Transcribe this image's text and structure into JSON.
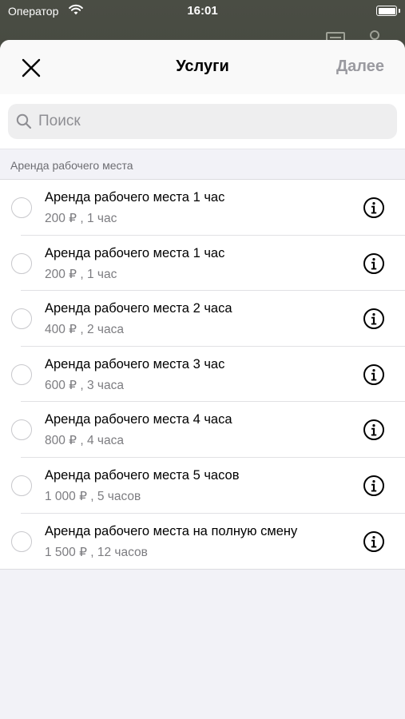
{
  "status_bar": {
    "carrier": "Оператор",
    "time": "16:01"
  },
  "nav": {
    "close_icon": "close-icon",
    "title": "Услуги",
    "next_label": "Далее"
  },
  "search": {
    "placeholder": "Поиск",
    "value": ""
  },
  "section": {
    "title": "Аренда рабочего места"
  },
  "items": [
    {
      "title": "Аренда рабочего места 1 час",
      "subtitle": "200 ₽ , 1 час",
      "selected": false
    },
    {
      "title": "Аренда рабочего места 1 час",
      "subtitle": "200 ₽ , 1 час",
      "selected": false
    },
    {
      "title": "Аренда рабочего места 2 часа",
      "subtitle": "400 ₽ , 2 часа",
      "selected": false
    },
    {
      "title": "Аренда рабочего места 3 час",
      "subtitle": "600 ₽ , 3 часа",
      "selected": false
    },
    {
      "title": "Аренда рабочего места 4 часа",
      "subtitle": "800 ₽ , 4 часа",
      "selected": false
    },
    {
      "title": "Аренда рабочего места 5 часов",
      "subtitle": "1 000 ₽ , 5 часов",
      "selected": false
    },
    {
      "title": "Аренда рабочего места на полную смену",
      "subtitle": "1 500 ₽ , 12 часов",
      "selected": false
    }
  ],
  "colors": {
    "sheet_bg": "#f2f2f7",
    "disabled_action": "#9a9aa0",
    "secondary_text": "#7c7c80"
  }
}
